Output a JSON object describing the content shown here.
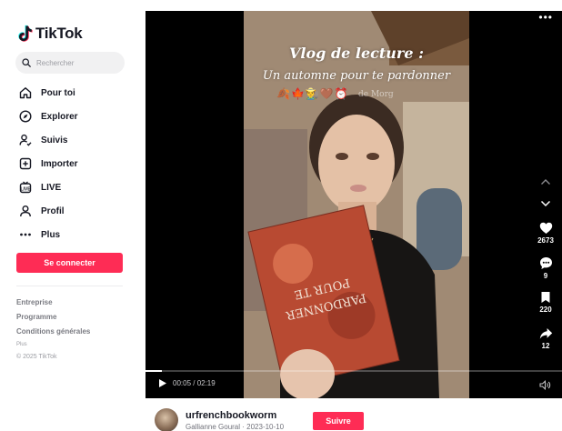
{
  "brand": {
    "name": "TikTok"
  },
  "search": {
    "placeholder": "Rechercher"
  },
  "nav": {
    "items": [
      {
        "label": "Pour toi",
        "icon": "home-icon"
      },
      {
        "label": "Explorer",
        "icon": "compass-icon"
      },
      {
        "label": "Suivis",
        "icon": "following-icon"
      },
      {
        "label": "Importer",
        "icon": "upload-icon"
      },
      {
        "label": "LIVE",
        "icon": "live-icon"
      },
      {
        "label": "Profil",
        "icon": "profile-icon"
      },
      {
        "label": "Plus",
        "icon": "more-icon"
      }
    ]
  },
  "login": {
    "label": "Se connecter"
  },
  "footer": {
    "links": [
      "Entreprise",
      "Programme",
      "Conditions générales"
    ],
    "more": "Plus",
    "copyright": "© 2025 TikTok"
  },
  "video": {
    "overlay_title_1": "Vlog de lecture :",
    "overlay_title_2": "Un automne pour te pardonner",
    "emojis": "🍂🍁👨‍🌾🤎⏰",
    "watermark": "de Morg",
    "current_time": "00:05",
    "duration": "02:19",
    "time_display": "00:05 / 02:19",
    "progress_fraction": 0.04
  },
  "actions": {
    "likes": "2673",
    "comments": "9",
    "saves": "220",
    "shares": "12"
  },
  "author": {
    "username": "urfrenchbookworm",
    "subtitle": "Gallianne Goural · 2023-10-10",
    "follow_label": "Suivre"
  },
  "colors": {
    "accent": "#fe2c55",
    "text": "#161823",
    "player_bg": "#000000"
  }
}
